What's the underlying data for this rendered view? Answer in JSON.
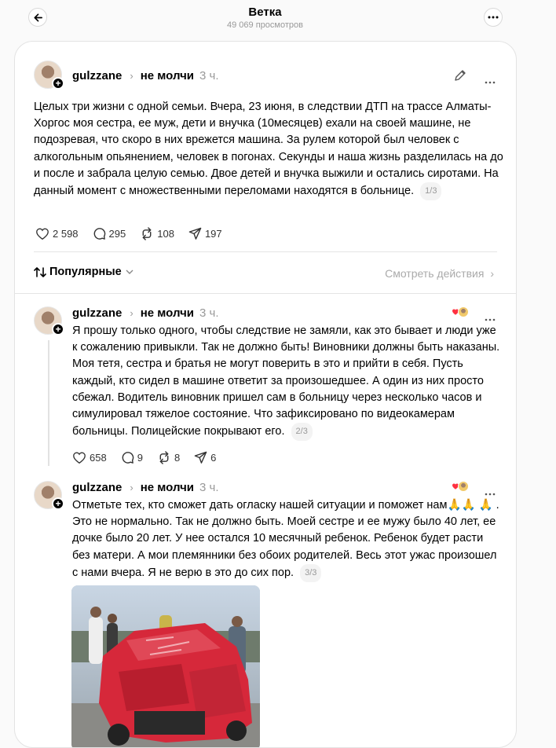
{
  "topbar": {
    "title": "Ветка",
    "views": "49 069 просмотров"
  },
  "main_post": {
    "username": "gulzzane",
    "topic": "не молчи",
    "time": "3 ч.",
    "text": "Целых три жизни с одной семьи. Вчера, 23 июня, в следствии ДТП на трассе Алматы-Хоргос моя сестра, ее муж, дети и внучка (10месяцев) ехали на своей машине, не подозревая, что скоро в них врежется машина. За рулем которой был человек с алкогольным опьянением, человек в погонах. Секунды и наша жизнь разделилась на до и после и забрала целую семью. Двое детей и внучка выжили и остались сиротами. На данный момент с множественными переломами находятся в больнице.",
    "pager": "1/3",
    "likes": "2 598",
    "replies": "295",
    "reposts": "108",
    "shares": "197"
  },
  "sort": {
    "label": "Популярные",
    "see_actions": "Смотреть действия"
  },
  "replies": [
    {
      "username": "gulzzane",
      "topic": "не молчи",
      "time": "3 ч.",
      "text": "Я прошу только одного, чтобы следствие не замяли, как это бывает и люди уже к сожалению привыкли. Так не должно быть! Виновники должны быть наказаны. Моя тетя, сестра и братья не могут поверить в это и прийти в себя. Пусть каждый, кто сидел в машине ответит за произошедшее. А один из них просто сбежал. Водитель виновник пришел сам в больницу через несколько часов и симулировал тяжелое состояние. Что зафиксировано по видеокамерам больницы. Полицейские покрывают его.",
      "pager": "2/3",
      "likes": "658",
      "replies": "9",
      "reposts": "8",
      "shares": "6"
    },
    {
      "username": "gulzzane",
      "topic": "не молчи",
      "time": "3 ч.",
      "text_a": "Отметьте тех, кто сможет дать огласку нашей ситуации и поможет нам🙏🙏",
      "text_b": "🙏 . Это не нормально. Так не должно быть. Моей сестре и ее мужу было 40 лет, ее дочке было 20 лет. У нее остался 10 месячный ребенок. Ребенок будет расти без матери. А мои племянники без обоих родителей. Весь этот ужас произошел с нами вчера. Я не верю в это до сих пор.",
      "pager": "3/3"
    }
  ],
  "colors": {
    "accent_heart": "#ff3040",
    "muted": "#999999",
    "car_red": "#d6283a"
  },
  "icons": [
    "back-arrow-icon",
    "more-icon",
    "edit-pencil-icon",
    "heart-icon",
    "comment-icon",
    "repost-icon",
    "share-icon",
    "sort-icon",
    "chevron-down-icon",
    "chevron-right-icon"
  ]
}
